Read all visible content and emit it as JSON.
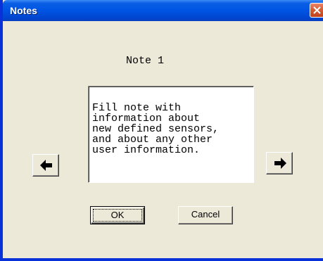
{
  "window": {
    "title": "Notes"
  },
  "note": {
    "title": "Note 1",
    "lines": [
      "Fill note with",
      "information about",
      "new defined sensors,",
      "and about any other",
      "user information."
    ]
  },
  "buttons": {
    "ok_label": "OK",
    "cancel_label": "Cancel"
  },
  "icons": {
    "close": "close-icon",
    "previous": "arrow-left-icon",
    "next": "arrow-right-icon"
  },
  "colors": {
    "titlebar": "#0054e3",
    "dialog_background": "#ece9d8",
    "close_button": "#d85d34"
  }
}
